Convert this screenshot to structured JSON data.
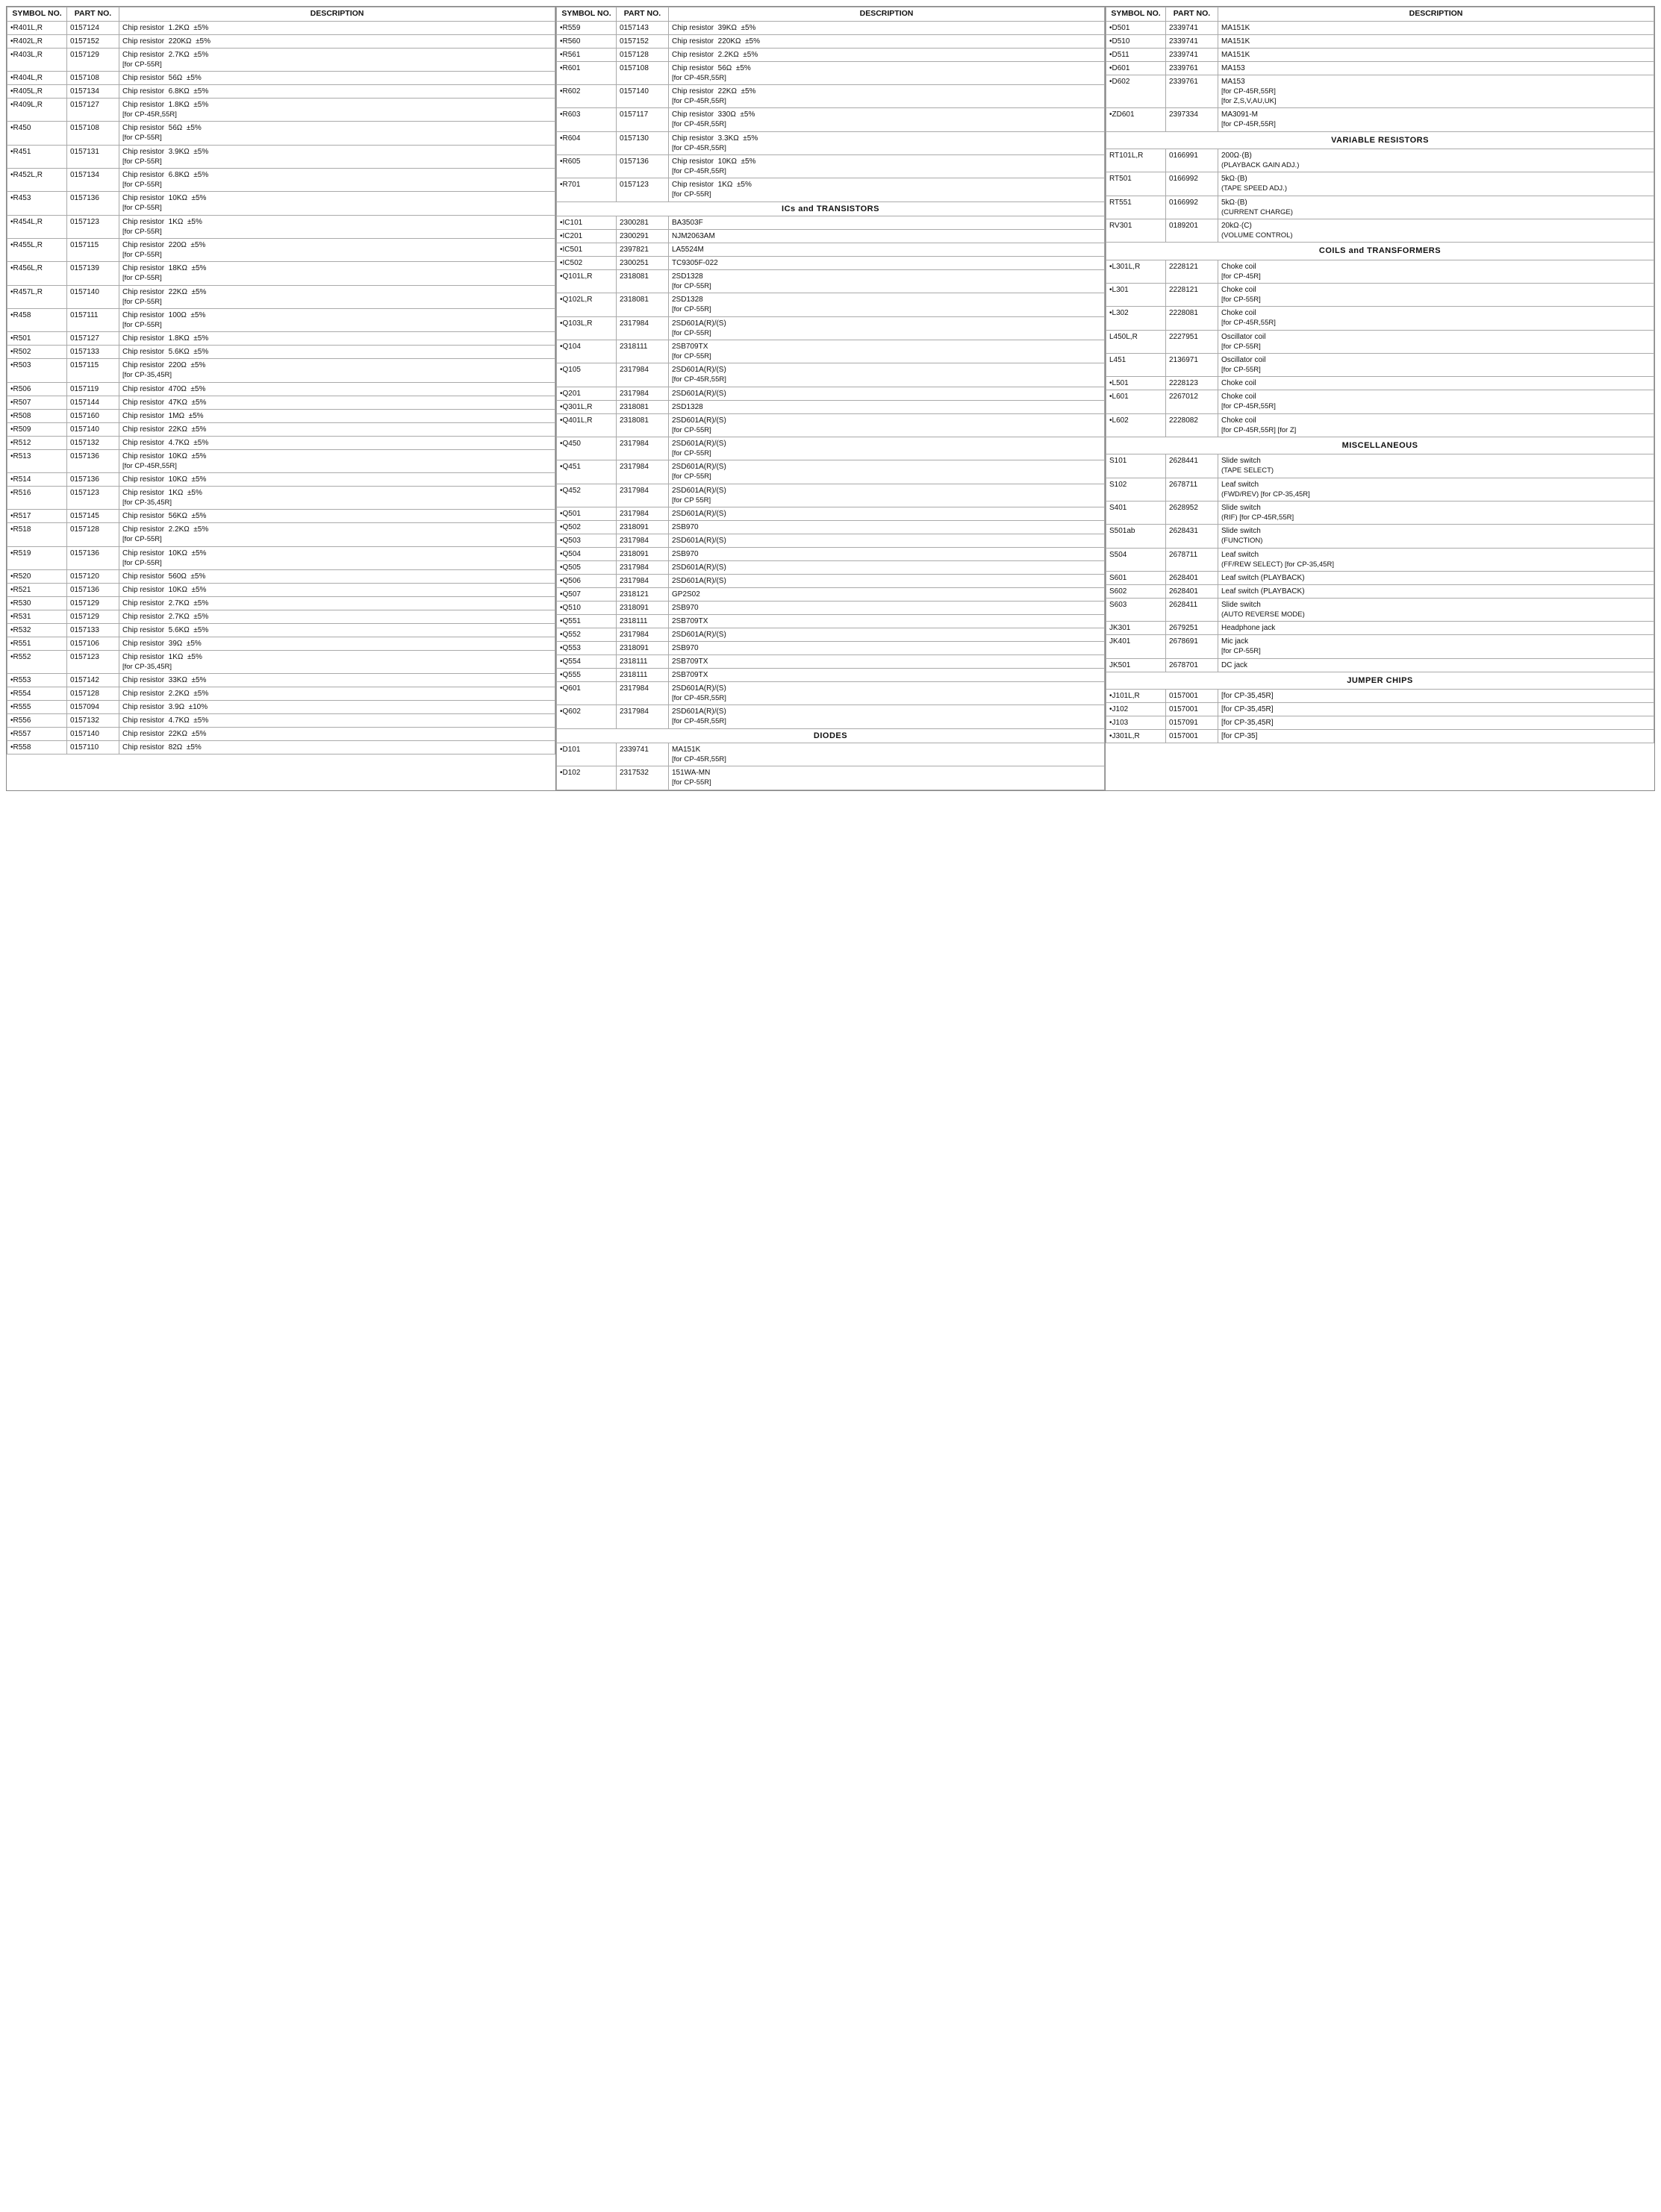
{
  "col1": {
    "headers": [
      "SYMBOL NO.",
      "PART NO.",
      "DESCRIPTION"
    ],
    "rows": [
      {
        "sym": "•R401L,R",
        "part": "0157124",
        "desc": "Chip resistor",
        "val": "1.2KΩ",
        "tol": "±5%",
        "note": ""
      },
      {
        "sym": "•R402L,R",
        "part": "0157152",
        "desc": "Chip resistor",
        "val": "220KΩ",
        "tol": "±5%",
        "note": ""
      },
      {
        "sym": "•R403L,R",
        "part": "0157129",
        "desc": "Chip resistor",
        "val": "2.7KΩ",
        "tol": "±5%",
        "note": "[for CP-55R]"
      },
      {
        "sym": "•R404L,R",
        "part": "0157108",
        "desc": "Chip resistor",
        "val": "56Ω",
        "tol": "±5%",
        "note": ""
      },
      {
        "sym": "•R405L,R",
        "part": "0157134",
        "desc": "Chip resistor",
        "val": "6.8KΩ",
        "tol": "±5%",
        "note": ""
      },
      {
        "sym": "•R409L,R",
        "part": "0157127",
        "desc": "Chip resistor",
        "val": "1.8KΩ",
        "tol": "±5%",
        "note": "[for CP-45R,55R]"
      },
      {
        "sym": "•R450",
        "part": "0157108",
        "desc": "Chip resistor",
        "val": "56Ω",
        "tol": "±5%",
        "note": "[for CP-55R]"
      },
      {
        "sym": "•R451",
        "part": "0157131",
        "desc": "Chip resistor",
        "val": "3.9KΩ",
        "tol": "±5%",
        "note": "[for CP-55R]"
      },
      {
        "sym": "•R452L,R",
        "part": "0157134",
        "desc": "Chip resistor",
        "val": "6.8KΩ",
        "tol": "±5%",
        "note": "[for CP-55R]"
      },
      {
        "sym": "•R453",
        "part": "0157136",
        "desc": "Chip resistor",
        "val": "10KΩ",
        "tol": "±5%",
        "note": "[for CP-55R]"
      },
      {
        "sym": "•R454L,R",
        "part": "0157123",
        "desc": "Chip resistor",
        "val": "1KΩ",
        "tol": "±5%",
        "note": "[for CP-55R]"
      },
      {
        "sym": "•R455L,R",
        "part": "0157115",
        "desc": "Chip resistor",
        "val": "220Ω",
        "tol": "±5%",
        "note": "[for CP-55R]"
      },
      {
        "sym": "•R456L,R",
        "part": "0157139",
        "desc": "Chip resistor",
        "val": "18KΩ",
        "tol": "±5%",
        "note": "[for CP-55R]"
      },
      {
        "sym": "•R457L,R",
        "part": "0157140",
        "desc": "Chip resistor",
        "val": "22KΩ",
        "tol": "±5%",
        "note": "[for CP-55R]"
      },
      {
        "sym": "•R458",
        "part": "0157111",
        "desc": "Chip resistor",
        "val": "100Ω",
        "tol": "±5%",
        "note": "[for CP-55R]"
      },
      {
        "sym": "•R501",
        "part": "0157127",
        "desc": "Chip resistor",
        "val": "1.8KΩ",
        "tol": "±5%",
        "note": ""
      },
      {
        "sym": "•R502",
        "part": "0157133",
        "desc": "Chip resistor",
        "val": "5.6KΩ",
        "tol": "±5%",
        "note": ""
      },
      {
        "sym": "•R503",
        "part": "0157115",
        "desc": "Chip resistor",
        "val": "220Ω",
        "tol": "±5%",
        "note": "[for CP-35,45R]"
      },
      {
        "sym": "•R506",
        "part": "0157119",
        "desc": "Chip resistor",
        "val": "470Ω",
        "tol": "±5%",
        "note": ""
      },
      {
        "sym": "•R507",
        "part": "0157144",
        "desc": "Chip resistor",
        "val": "47KΩ",
        "tol": "±5%",
        "note": ""
      },
      {
        "sym": "•R508",
        "part": "0157160",
        "desc": "Chip resistor",
        "val": "1MΩ",
        "tol": "±5%",
        "note": ""
      },
      {
        "sym": "•R509",
        "part": "0157140",
        "desc": "Chip resistor",
        "val": "22KΩ",
        "tol": "±5%",
        "note": ""
      },
      {
        "sym": "•R512",
        "part": "0157132",
        "desc": "Chip resistor",
        "val": "4.7KΩ",
        "tol": "±5%",
        "note": ""
      },
      {
        "sym": "•R513",
        "part": "0157136",
        "desc": "Chip resistor",
        "val": "10KΩ",
        "tol": "±5%",
        "note": "[for CP-45R,55R]"
      },
      {
        "sym": "•R514",
        "part": "0157136",
        "desc": "Chip resistor",
        "val": "10KΩ",
        "tol": "±5%",
        "note": ""
      },
      {
        "sym": "•R516",
        "part": "0157123",
        "desc": "Chip resistor",
        "val": "1KΩ",
        "tol": "±5%",
        "note": "[for CP-35,45R]"
      },
      {
        "sym": "•R517",
        "part": "0157145",
        "desc": "Chip resistor",
        "val": "56KΩ",
        "tol": "±5%",
        "note": ""
      },
      {
        "sym": "•R518",
        "part": "0157128",
        "desc": "Chip resistor",
        "val": "2.2KΩ",
        "tol": "±5%",
        "note": "[for CP-55R]"
      },
      {
        "sym": "•R519",
        "part": "0157136",
        "desc": "Chip resistor",
        "val": "10KΩ",
        "tol": "±5%",
        "note": "[for CP-55R]"
      },
      {
        "sym": "•R520",
        "part": "0157120",
        "desc": "Chip resistor",
        "val": "560Ω",
        "tol": "±5%",
        "note": ""
      },
      {
        "sym": "•R521",
        "part": "0157136",
        "desc": "Chip resistor",
        "val": "10KΩ",
        "tol": "±5%",
        "note": ""
      },
      {
        "sym": "•R530",
        "part": "0157129",
        "desc": "Chip resistor",
        "val": "2.7KΩ",
        "tol": "±5%",
        "note": ""
      },
      {
        "sym": "•R531",
        "part": "0157129",
        "desc": "Chip resistor",
        "val": "2.7KΩ",
        "tol": "±5%",
        "note": ""
      },
      {
        "sym": "•R532",
        "part": "0157133",
        "desc": "Chip resistor",
        "val": "5.6KΩ",
        "tol": "±5%",
        "note": ""
      },
      {
        "sym": "•R551",
        "part": "0157106",
        "desc": "Chip resistor",
        "val": "39Ω",
        "tol": "±5%",
        "note": ""
      },
      {
        "sym": "•R552",
        "part": "0157123",
        "desc": "Chip resistor",
        "val": "1KΩ",
        "tol": "±5%",
        "note": "[for CP-35,45R]"
      },
      {
        "sym": "•R553",
        "part": "0157142",
        "desc": "Chip resistor",
        "val": "33KΩ",
        "tol": "±5%",
        "note": ""
      },
      {
        "sym": "•R554",
        "part": "0157128",
        "desc": "Chip resistor",
        "val": "2.2KΩ",
        "tol": "±5%",
        "note": ""
      },
      {
        "sym": "•R555",
        "part": "0157094",
        "desc": "Chip resistor",
        "val": "3.9Ω",
        "tol": "±10%",
        "note": ""
      },
      {
        "sym": "•R556",
        "part": "0157132",
        "desc": "Chip resistor",
        "val": "4.7KΩ",
        "tol": "±5%",
        "note": ""
      },
      {
        "sym": "•R557",
        "part": "0157140",
        "desc": "Chip resistor",
        "val": "22KΩ",
        "tol": "±5%",
        "note": ""
      },
      {
        "sym": "•R558",
        "part": "0157110",
        "desc": "Chip resistor",
        "val": "82Ω",
        "tol": "±5%",
        "note": ""
      }
    ]
  },
  "col2": {
    "headers": [
      "SYMBOL NO.",
      "PART NO.",
      "DESCRIPTION"
    ],
    "rows": [
      {
        "sym": "•R559",
        "part": "0157143",
        "desc": "Chip resistor",
        "val": "39KΩ",
        "tol": "±5%",
        "note": ""
      },
      {
        "sym": "•R560",
        "part": "0157152",
        "desc": "Chip resistor",
        "val": "220KΩ",
        "tol": "±5%",
        "note": ""
      },
      {
        "sym": "•R561",
        "part": "0157128",
        "desc": "Chip resistor",
        "val": "2.2KΩ",
        "tol": "±5%",
        "note": ""
      },
      {
        "sym": "•R601",
        "part": "0157108",
        "desc": "Chip resistor",
        "val": "56Ω",
        "tol": "±5%",
        "note": "[for CP-45R,55R]"
      },
      {
        "sym": "•R602",
        "part": "0157140",
        "desc": "Chip resistor",
        "val": "22KΩ",
        "tol": "±5%",
        "note": "[for CP-45R,55R]"
      },
      {
        "sym": "•R603",
        "part": "0157117",
        "desc": "Chip resistor",
        "val": "330Ω",
        "tol": "±5%",
        "note": "[for CP-45R,55R]"
      },
      {
        "sym": "•R604",
        "part": "0157130",
        "desc": "Chip resistor",
        "val": "3.3KΩ",
        "tol": "±5%",
        "note": "[for CP-45R,55R]"
      },
      {
        "sym": "•R605",
        "part": "0157136",
        "desc": "Chip resistor",
        "val": "10KΩ",
        "tol": "±5%",
        "note": "[for CP-45R,55R]"
      },
      {
        "sym": "•R701",
        "part": "0157123",
        "desc": "Chip resistor",
        "val": "1KΩ",
        "tol": "±5%",
        "note": "[for CP-55R]"
      }
    ],
    "ics_header": "ICs and TRANSISTORS",
    "ics": [
      {
        "sym": "•IC101",
        "part": "2300281",
        "desc": "BA3503F"
      },
      {
        "sym": "•IC201",
        "part": "2300291",
        "desc": "NJM2063AM"
      },
      {
        "sym": "•IC501",
        "part": "2397821",
        "desc": "LA5524M"
      },
      {
        "sym": "•IC502",
        "part": "2300251",
        "desc": "TC9305F-022"
      },
      {
        "sym": "•Q101L,R",
        "part": "2318081",
        "desc": "2SD1328",
        "note": "[for CP-55R]"
      },
      {
        "sym": "•Q102L,R",
        "part": "2318081",
        "desc": "2SD1328",
        "note": "[for CP-55R]"
      },
      {
        "sym": "•Q103L,R",
        "part": "2317984",
        "desc": "2SD601A(R)/(S)",
        "note": "[for CP-55R]"
      },
      {
        "sym": "•Q104",
        "part": "2318111",
        "desc": "2SB709TX",
        "note": "[for CP-55R]"
      },
      {
        "sym": "•Q105",
        "part": "2317984",
        "desc": "2SD601A(R)/(S)",
        "note": "[for CP-45R,55R]"
      },
      {
        "sym": "•Q201",
        "part": "2317984",
        "desc": "2SD601A(R)/(S)"
      },
      {
        "sym": "•Q301L,R",
        "part": "2318081",
        "desc": "2SD1328"
      },
      {
        "sym": "•Q401L,R",
        "part": "2318081",
        "desc": "2SD601A(R)/(S)",
        "note": "[for CP-55R]"
      },
      {
        "sym": "•Q450",
        "part": "2317984",
        "desc": "2SD601A(R)/(S)",
        "note": "[for CP-55R]"
      },
      {
        "sym": "•Q451",
        "part": "2317984",
        "desc": "2SD601A(R)/(S)",
        "note": "[for CP-55R]"
      },
      {
        "sym": "•Q452",
        "part": "2317984",
        "desc": "2SD601A(R)/(S)",
        "note": "[for CP 55R]"
      },
      {
        "sym": "•Q501",
        "part": "2317984",
        "desc": "2SD601A(R)/(S)"
      },
      {
        "sym": "•Q502",
        "part": "2318091",
        "desc": "2SB970"
      },
      {
        "sym": "•Q503",
        "part": "2317984",
        "desc": "2SD601A(R)/(S)"
      },
      {
        "sym": "•Q504",
        "part": "2318091",
        "desc": "2SB970"
      },
      {
        "sym": "•Q505",
        "part": "2317984",
        "desc": "2SD601A(R)/(S)"
      },
      {
        "sym": "•Q506",
        "part": "2317984",
        "desc": "2SD601A(R)/(S)"
      },
      {
        "sym": "•Q507",
        "part": "2318121",
        "desc": "GP2S02"
      },
      {
        "sym": "•Q510",
        "part": "2318091",
        "desc": "2SB970"
      },
      {
        "sym": "•Q551",
        "part": "2318111",
        "desc": "2SB709TX"
      },
      {
        "sym": "•Q552",
        "part": "2317984",
        "desc": "2SD601A(R)/(S)"
      },
      {
        "sym": "•Q553",
        "part": "2318091",
        "desc": "2SB970"
      },
      {
        "sym": "•Q554",
        "part": "2318111",
        "desc": "2SB709TX"
      },
      {
        "sym": "•Q555",
        "part": "2318111",
        "desc": "2SB709TX"
      },
      {
        "sym": "•Q601",
        "part": "2317984",
        "desc": "2SD601A(R)/(S)",
        "note": "[for CP-45R,55R]"
      },
      {
        "sym": "•Q602",
        "part": "2317984",
        "desc": "2SD601A(R)/(S)",
        "note": "[for CP-45R,55R]"
      }
    ],
    "diodes_header": "DIODES",
    "diodes": [
      {
        "sym": "•D101",
        "part": "2339741",
        "desc": "MA151K",
        "note": "[for CP-45R,55R]"
      },
      {
        "sym": "•D102",
        "part": "2317532",
        "desc": "151WA-MN",
        "note": "[for CP-55R]"
      }
    ]
  },
  "col3": {
    "headers": [
      "SYMBOL NO.",
      "PART NO.",
      "DESCRIPTION"
    ],
    "diodes": [
      {
        "sym": "•D501",
        "part": "2339741",
        "desc": "MA151K"
      },
      {
        "sym": "•D510",
        "part": "2339741",
        "desc": "MA151K"
      },
      {
        "sym": "•D511",
        "part": "2339741",
        "desc": "MA151K"
      },
      {
        "sym": "•D601",
        "part": "2339761",
        "desc": "MA153"
      },
      {
        "sym": "•D602",
        "part": "2339761",
        "desc": "MA153",
        "note": "[for CP-45R,55R]",
        "note2": "[for Z,S,V,AU,UK]"
      },
      {
        "sym": "•ZD601",
        "part": "2397334",
        "desc": "MA3091-M",
        "note": "[for CP-45R,55R]"
      }
    ],
    "varistor_header": "VARIABLE RESISTORS",
    "varistors": [
      {
        "sym": "RT101L,R",
        "part": "0166991",
        "desc": "200Ω·(B)",
        "note": "(PLAYBACK GAIN ADJ.)"
      },
      {
        "sym": "RT501",
        "part": "0166992",
        "desc": "5kΩ·(B)",
        "note": "(TAPE SPEED ADJ.)"
      },
      {
        "sym": "RT551",
        "part": "0166992",
        "desc": "5kΩ·(B)",
        "note": "(CURRENT CHARGE)"
      },
      {
        "sym": "RV301",
        "part": "0189201",
        "desc": "20kΩ·(C)",
        "note": "(VOLUME CONTROL)"
      }
    ],
    "coils_header": "COILS and TRANSFORMERS",
    "coils": [
      {
        "sym": "•L301L,R",
        "part": "2228121",
        "desc": "Choke coil",
        "note": "[for CP-45R]"
      },
      {
        "sym": "•L301",
        "part": "2228121",
        "desc": "Choke coil",
        "note": "[for CP-55R]"
      },
      {
        "sym": "•L302",
        "part": "2228081",
        "desc": "Choke coil",
        "note": "[for CP-45R,55R]"
      },
      {
        "sym": "L450L,R",
        "part": "2227951",
        "desc": "Oscillator coil",
        "note": "[for CP-55R]"
      },
      {
        "sym": "L451",
        "part": "2136971",
        "desc": "Oscillator coil",
        "note": "[for CP-55R]"
      },
      {
        "sym": "•L501",
        "part": "2228123",
        "desc": "Choke coil"
      },
      {
        "sym": "•L601",
        "part": "2267012",
        "desc": "Choke coil",
        "note": "[for CP-45R,55R]"
      },
      {
        "sym": "•L602",
        "part": "2228082",
        "desc": "Choke coil",
        "note": "[for CP-45R,55R] [for Z]"
      }
    ],
    "misc_header": "MISCELLANEOUS",
    "misc": [
      {
        "sym": "S101",
        "part": "2628441",
        "desc": "Slide switch",
        "note": "(TAPE SELECT)"
      },
      {
        "sym": "S102",
        "part": "2678711",
        "desc": "Leaf switch",
        "note": "(FWD/REV) [for CP-35,45R]"
      },
      {
        "sym": "S401",
        "part": "2628952",
        "desc": "Slide switch",
        "note": "(RIF) [for CP-45R,55R]"
      },
      {
        "sym": "S501ab",
        "part": "2628431",
        "desc": "Slide switch",
        "note": "(FUNCTION)"
      },
      {
        "sym": "S504",
        "part": "2678711",
        "desc": "Leaf switch",
        "note": "(FF/REW SELECT) [for CP-35,45R]"
      },
      {
        "sym": "S601",
        "part": "2628401",
        "desc": "Leaf switch (PLAYBACK)"
      },
      {
        "sym": "S602",
        "part": "2628401",
        "desc": "Leaf switch (PLAYBACK)"
      },
      {
        "sym": "S603",
        "part": "2628411",
        "desc": "Slide switch",
        "note": "(AUTO REVERSE MODE)"
      },
      {
        "sym": "JK301",
        "part": "2679251",
        "desc": "Headphone jack"
      },
      {
        "sym": "JK401",
        "part": "2678691",
        "desc": "Mic jack",
        "note": "[for CP-55R]"
      },
      {
        "sym": "JK501",
        "part": "2678701",
        "desc": "DC jack"
      }
    ],
    "jumper_header": "JUMPER CHIPS",
    "jumpers": [
      {
        "sym": "•J101L,R",
        "part": "0157001",
        "desc": "[for CP-35,45R]"
      },
      {
        "sym": "•J102",
        "part": "0157001",
        "desc": "[for CP-35,45R]"
      },
      {
        "sym": "•J103",
        "part": "0157091",
        "desc": "[for CP-35,45R]"
      },
      {
        "sym": "•J301L,R",
        "part": "0157001",
        "desc": "[for CP-35]"
      }
    ]
  }
}
